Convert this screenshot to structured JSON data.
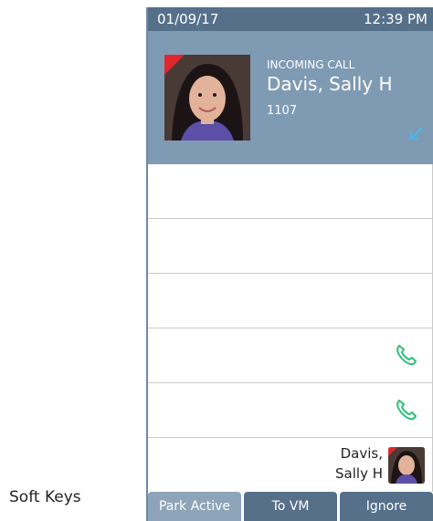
{
  "status": {
    "date": "01/09/17",
    "time": "12:39 PM"
  },
  "call": {
    "status_label": "INCOMING CALL",
    "caller_name": "Davis, Sally H",
    "extension": "1107"
  },
  "lines": [
    {
      "call_icon": null
    },
    {
      "call_icon": null
    },
    {
      "call_icon": null
    },
    {
      "call_icon": "phone-handset-icon"
    },
    {
      "call_icon": "phone-handset-icon"
    }
  ],
  "busy_line": {
    "name_line1": "Davis,",
    "name_line2": "Sally H"
  },
  "softkeys": {
    "caption": "Soft Keys",
    "keys": [
      {
        "label": "Park Active"
      },
      {
        "label": "To VM"
      },
      {
        "label": "Ignore"
      }
    ]
  },
  "colors": {
    "status_bar": "#56708a",
    "call_panel": "#7f9ab3",
    "call_icon": "#2fbf7a",
    "incoming_arrow": "#4bb6ea",
    "presence_badge": "#e0272b"
  }
}
